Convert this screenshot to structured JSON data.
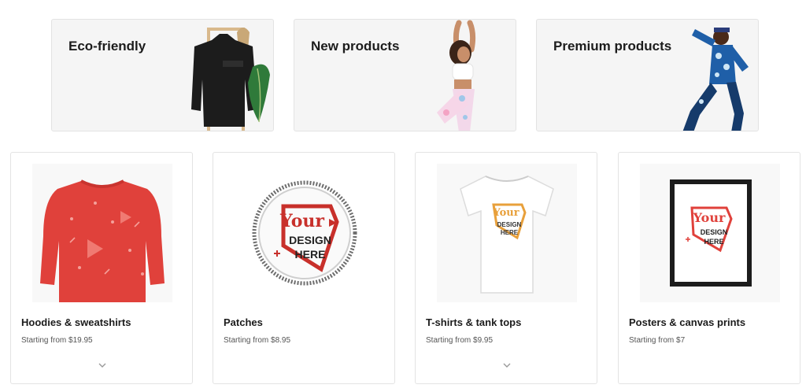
{
  "collections": [
    {
      "id": "eco",
      "label": "Eco-friendly"
    },
    {
      "id": "new",
      "label": "New products"
    },
    {
      "id": "premium",
      "label": "Premium products"
    }
  ],
  "products": [
    {
      "name": "Hoodies & sweatshirts",
      "price": "Starting from $19.95",
      "has_expand": true
    },
    {
      "name": "Patches",
      "price": "Starting from $8.95",
      "has_expand": false
    },
    {
      "name": "T-shirts & tank tops",
      "price": "Starting from $9.95",
      "has_expand": true
    },
    {
      "name": "Posters & canvas prints",
      "price": "Starting from $7",
      "has_expand": false
    }
  ],
  "mockup_text": {
    "line1": "Your",
    "line2": "DESIGN",
    "line3": "HERE"
  },
  "icons": {
    "expand": "chevron-down-icon"
  },
  "colors": {
    "brand_red": "#e0413b",
    "card_bg": "#f5f5f5",
    "border": "#e3e3e3"
  }
}
